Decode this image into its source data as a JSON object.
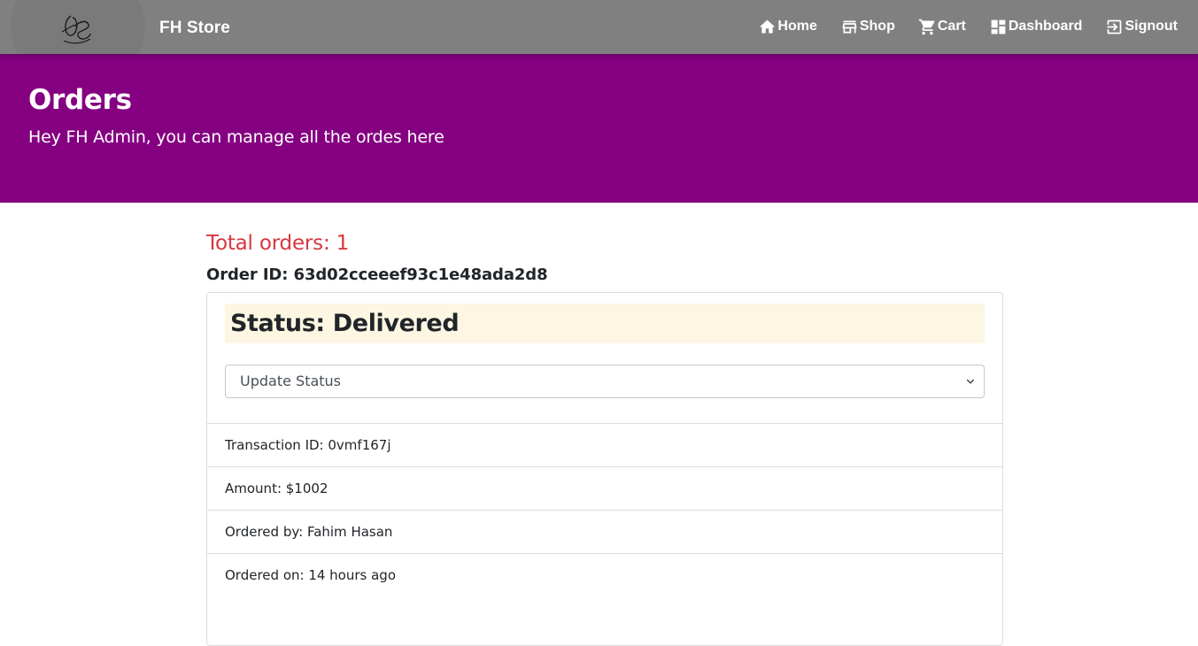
{
  "navbar": {
    "brand": "FH Store",
    "logo_icon": "fs-monogram-logo",
    "links": [
      {
        "label": "Home",
        "icon": "home-icon"
      },
      {
        "label": "Shop",
        "icon": "store-icon"
      },
      {
        "label": "Cart",
        "icon": "cart-icon"
      },
      {
        "label": "Dashboard",
        "icon": "dashboard-icon"
      },
      {
        "label": "Signout",
        "icon": "signout-icon"
      }
    ],
    "background_color": "#808080"
  },
  "hero": {
    "title": "Orders",
    "subtitle": "Hey FH Admin, you can manage all the ordes here",
    "background_color": "#850081"
  },
  "orders": {
    "total_label": "Total orders: 1",
    "order_id_label": "Order ID: 63d02cceeef93c1e48ada2d8",
    "status_label": "Status: Delivered",
    "update_select": {
      "selected": "Update Status"
    },
    "details": [
      "Transaction ID: 0vmf167j",
      "Amount: $1002",
      "Ordered by: Fahim Hasan",
      "Ordered on: 14 hours ago"
    ],
    "accent_color": "#d9363e"
  }
}
